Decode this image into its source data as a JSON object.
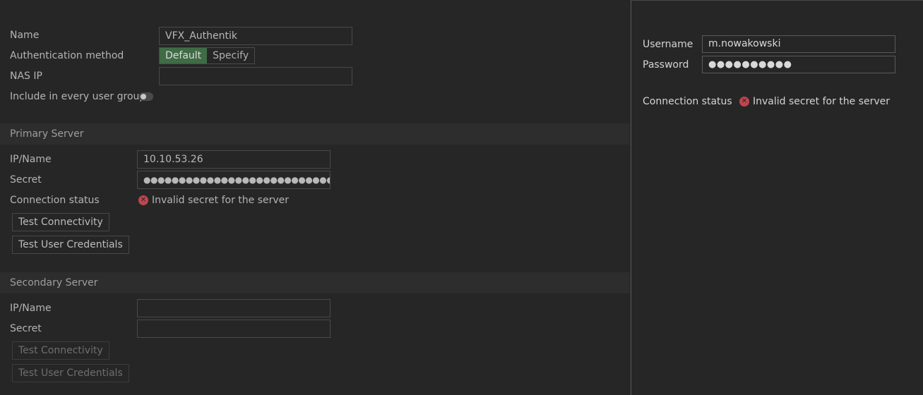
{
  "general": {
    "name_label": "Name",
    "name_value": "VFX_Authentik",
    "auth_method_label": "Authentication method",
    "auth_default": "Default",
    "auth_specify": "Specify",
    "nas_ip_label": "NAS IP",
    "nas_ip_value": "",
    "include_label": "Include in every user group",
    "include_enabled": false
  },
  "primary": {
    "title": "Primary Server",
    "ip_label": "IP/Name",
    "ip_value": "10.10.53.26",
    "secret_label": "Secret",
    "secret_value": "●●●●●●●●●●●●●●●●●●●●●●●●●●●●●●●●",
    "status_label": "Connection status",
    "status_text": "Invalid secret for the server",
    "test_connectivity": "Test Connectivity",
    "test_credentials": "Test User Credentials"
  },
  "secondary": {
    "title": "Secondary Server",
    "ip_label": "IP/Name",
    "ip_value": "",
    "secret_label": "Secret",
    "secret_value": "",
    "test_connectivity": "Test Connectivity",
    "test_credentials": "Test User Credentials"
  },
  "credentials_panel": {
    "username_label": "Username",
    "username_value": "m.nowakowski",
    "password_label": "Password",
    "password_value": "●●●●●●●●●●",
    "status_label": "Connection status",
    "status_text": "Invalid secret for the server"
  },
  "colors": {
    "background": "#262626",
    "accent_green": "#3f6b45",
    "error_red": "#c0454f"
  }
}
